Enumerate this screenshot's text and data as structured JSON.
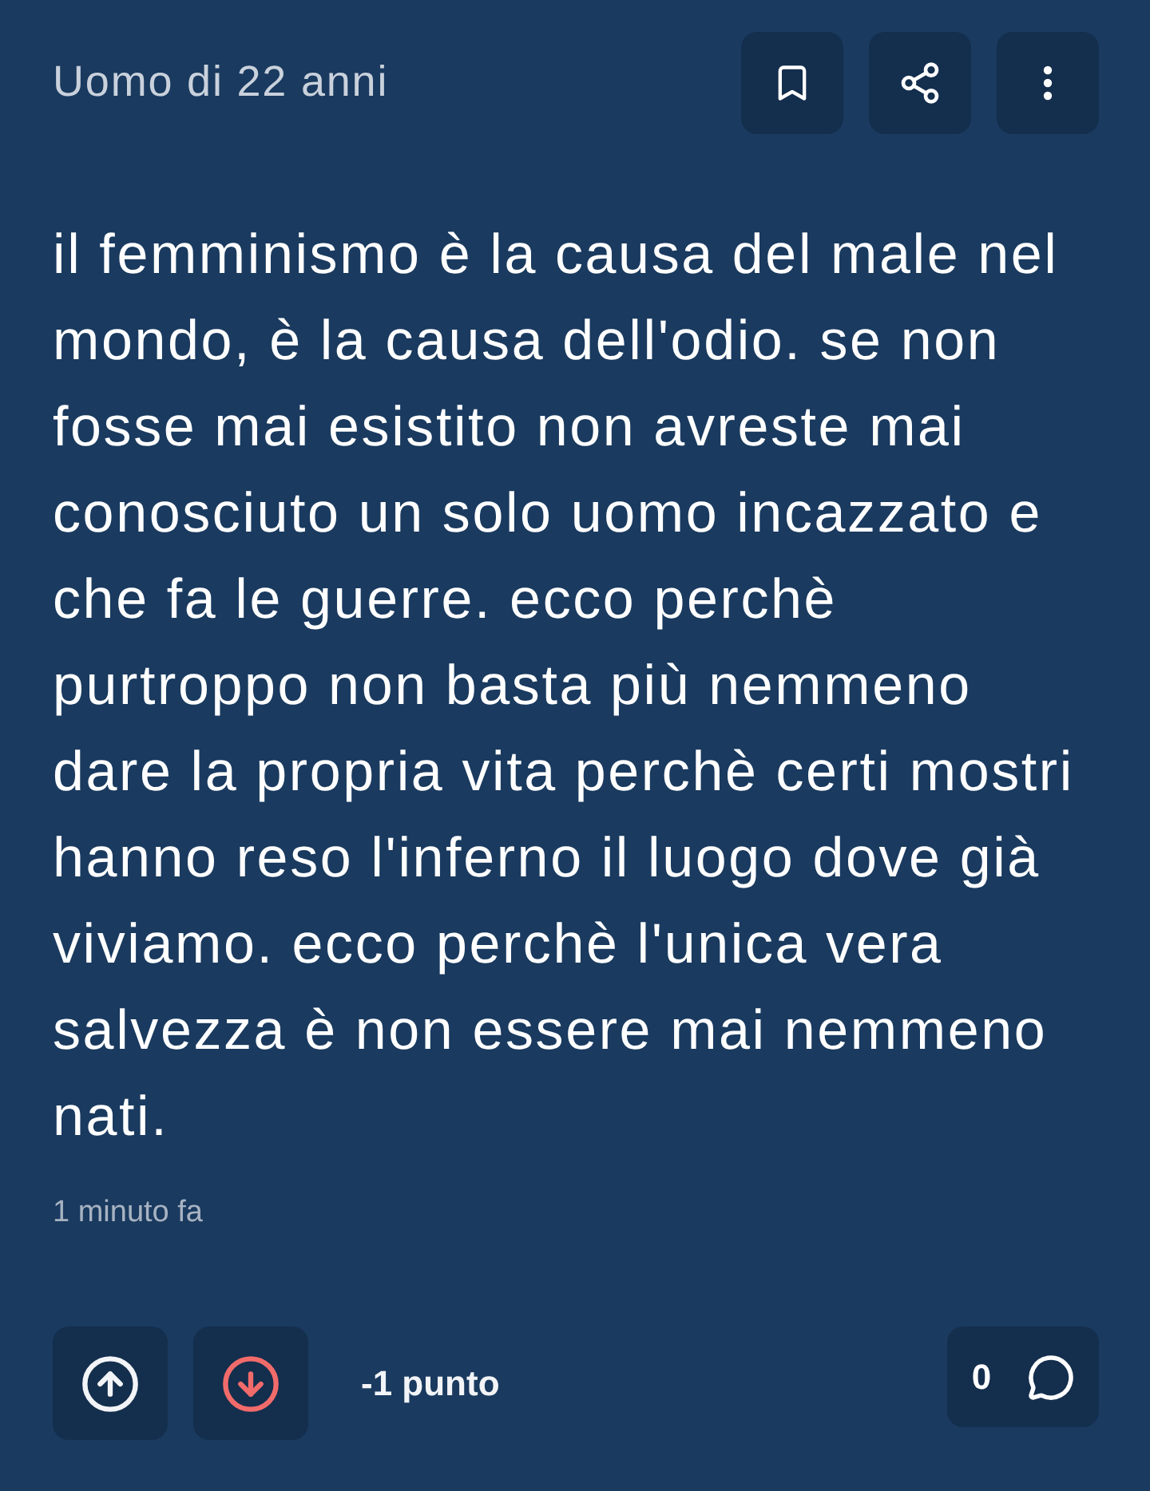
{
  "post": {
    "author": "Uomo di 22 anni",
    "body": "il femminismo è la causa del male nel mondo, è la causa dell'odio. se non fosse mai esistito non avreste mai conosciuto un solo uomo incazzato e che fa le guerre. ecco perchè purtroppo non basta più nemmeno dare la propria vita perchè certi mostri hanno reso l'inferno il luogo dove già viviamo. ecco perchè l'unica vera salvezza è non essere mai nemmeno nati.",
    "time": "1 minuto fa"
  },
  "votes": [
    {
      "kind": "up",
      "selected": false
    },
    {
      "kind": "down",
      "selected": true
    }
  ],
  "score": "-1 punto",
  "comments": {
    "count": "0"
  }
}
